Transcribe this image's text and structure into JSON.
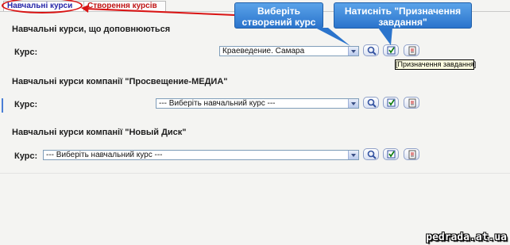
{
  "tabs": {
    "active_label": "Навчальні курси",
    "other_label": "Створення курсів"
  },
  "sections": [
    {
      "title": "Навчальні курси, що доповнюються",
      "course_label": "Курс:",
      "selected": "Краеведение. Самара"
    },
    {
      "title": "Навчальні курси компанії \"Просвещение-МЕДИА\"",
      "course_label": "Курс:",
      "selected": "--- Виберіть навчальний курс ---"
    },
    {
      "title": "Навчальні курси компанії \"Новый Диск\"",
      "course_label": "Курс:",
      "selected": "--- Виберіть навчальний курс ---"
    }
  ],
  "callouts": {
    "select_course": "Виберіть створений курс",
    "assign_task": "Натисніть \"Призначення завдання\""
  },
  "tooltip": "[Призначення завдання]",
  "watermark": "pedrada.at.ua",
  "icons": [
    "search-icon",
    "checkbox-icon",
    "report-icon"
  ],
  "colors": {
    "accent_red": "#d91414",
    "callout_blue": "#2b74cc",
    "tab_text": "#2525a8"
  }
}
